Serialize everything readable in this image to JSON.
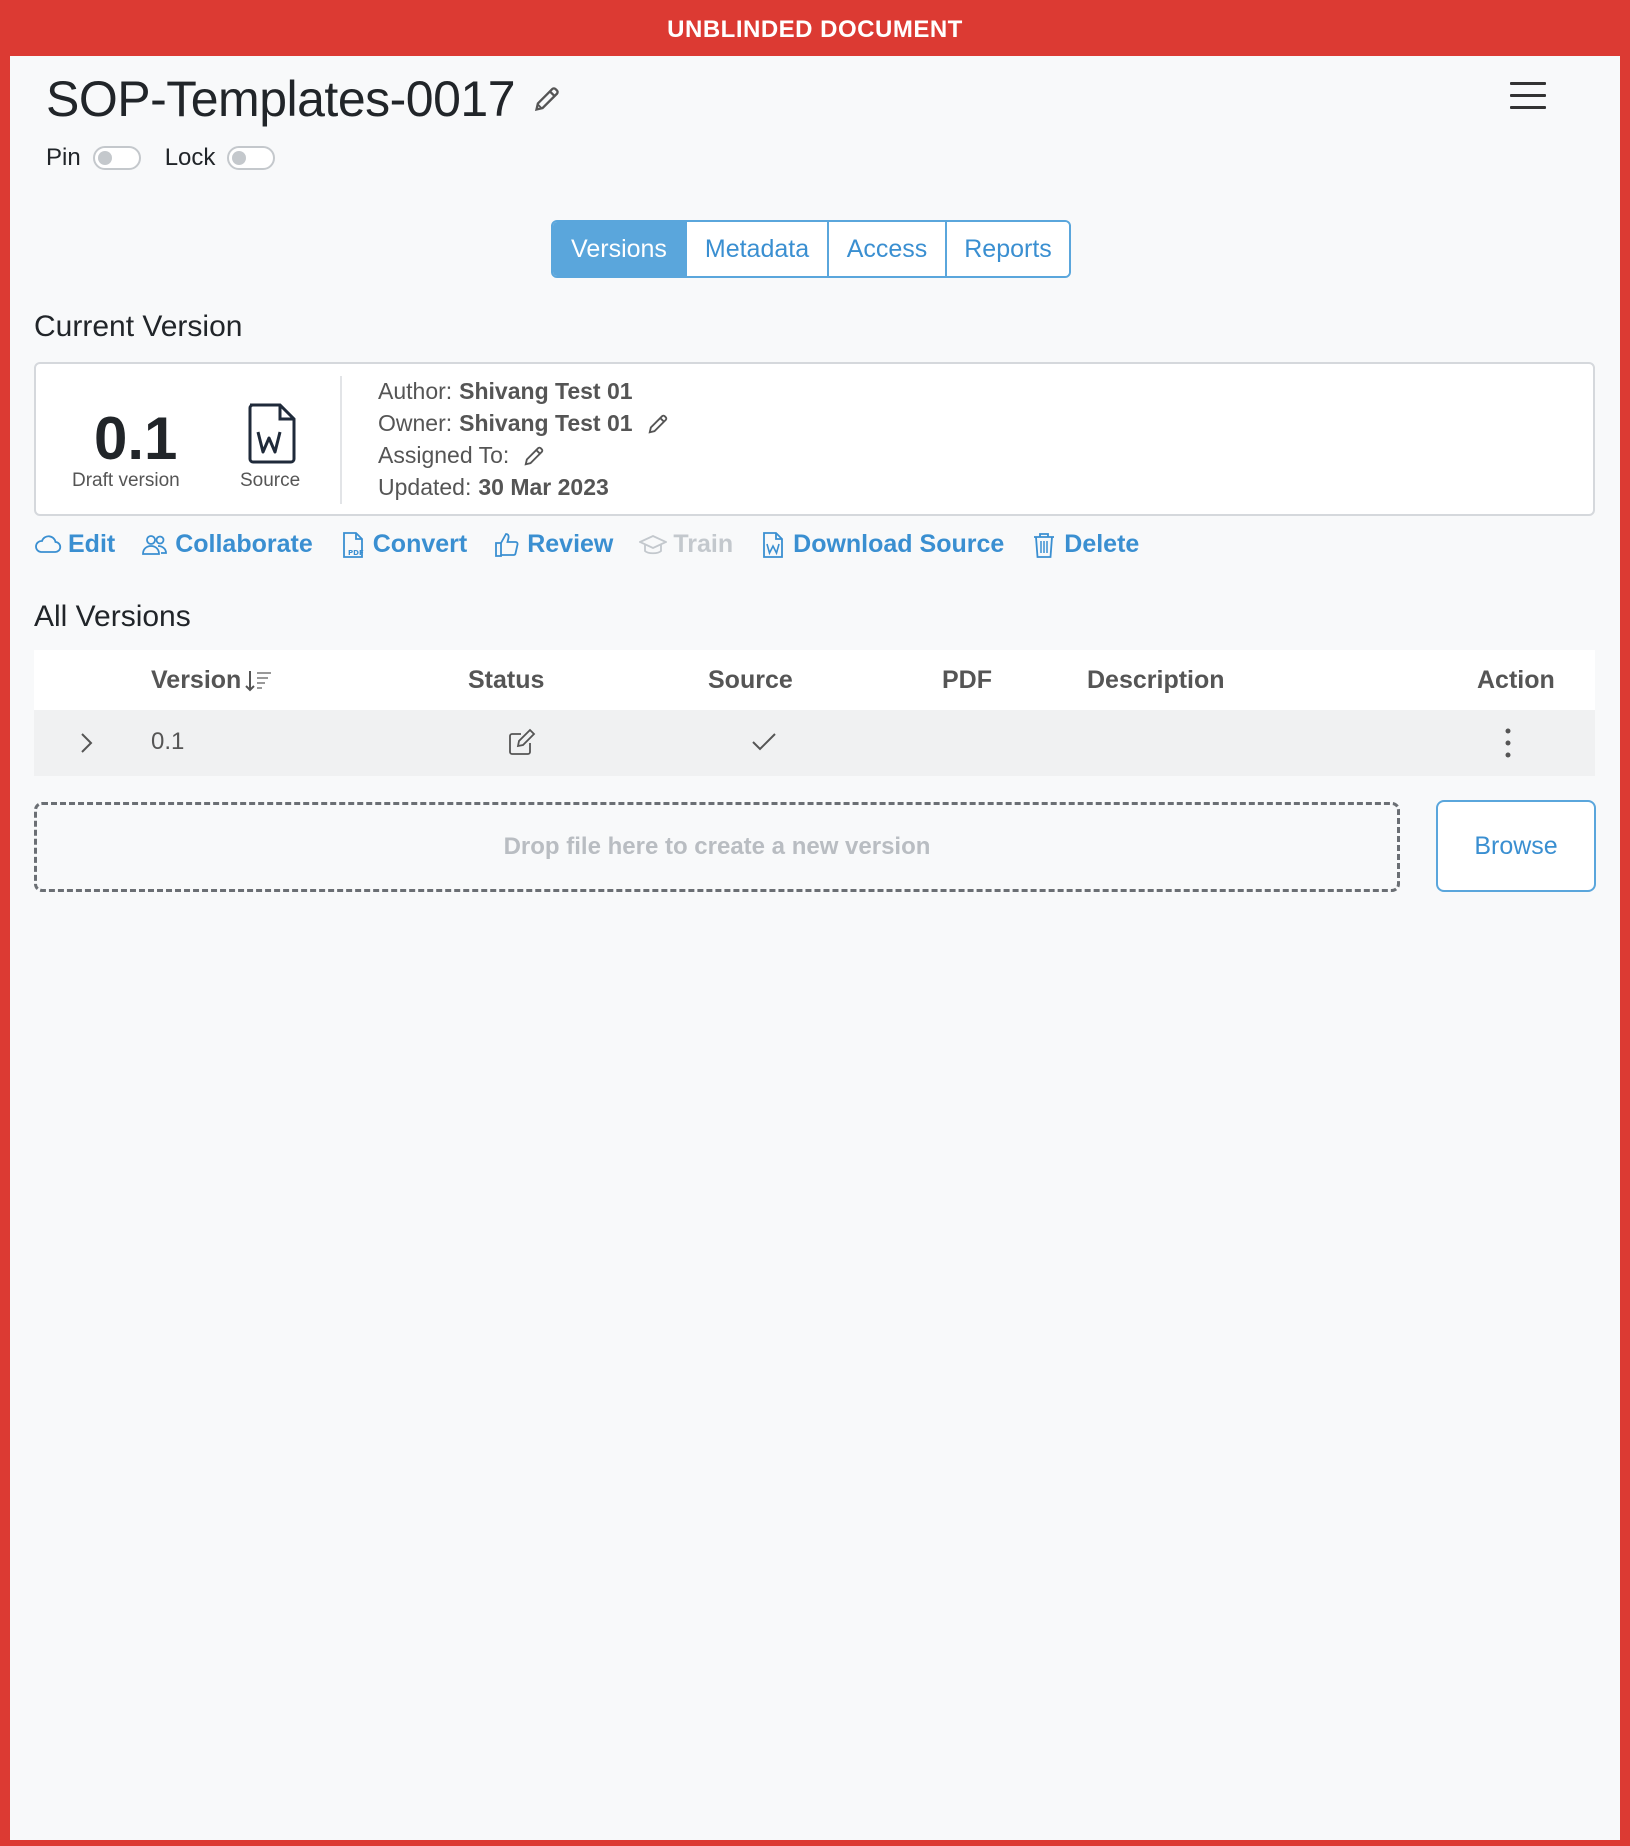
{
  "banner": {
    "text": "UNBLINDED DOCUMENT",
    "color": "#dc3a33"
  },
  "document": {
    "title": "SOP-Templates-0017"
  },
  "toggles": {
    "pin_label": "Pin",
    "lock_label": "Lock"
  },
  "tabs": [
    {
      "label": "Versions",
      "active": true
    },
    {
      "label": "Metadata",
      "active": false
    },
    {
      "label": "Access",
      "active": false
    },
    {
      "label": "Reports",
      "active": false
    }
  ],
  "current_version": {
    "section_title": "Current Version",
    "number": "0.1",
    "status_label": "Draft version",
    "source_label": "Source",
    "author_label": "Author:",
    "author_value": "Shivang Test 01",
    "owner_label": "Owner:",
    "owner_value": "Shivang Test 01",
    "assigned_label": "Assigned To:",
    "updated_label": "Updated:",
    "updated_value": "30 Mar 2023"
  },
  "actions": {
    "edit": "Edit",
    "collaborate": "Collaborate",
    "convert": "Convert",
    "review": "Review",
    "train": "Train",
    "download_source": "Download Source",
    "delete": "Delete"
  },
  "all_versions": {
    "section_title": "All Versions",
    "columns": {
      "version": "Version",
      "status": "Status",
      "source": "Source",
      "pdf": "PDF",
      "description": "Description",
      "action": "Action"
    },
    "rows": [
      {
        "version": "0.1",
        "status_icon": "edit-square-icon",
        "source_icon": "check-icon",
        "pdf": "",
        "description": ""
      }
    ]
  },
  "upload": {
    "drop_text": "Drop file here to create a new version",
    "browse_label": "Browse"
  },
  "colors": {
    "accent": "#5aa6dc",
    "link": "#3a8fd1",
    "disabled": "#c3c8cd",
    "banner": "#dc3a33"
  }
}
